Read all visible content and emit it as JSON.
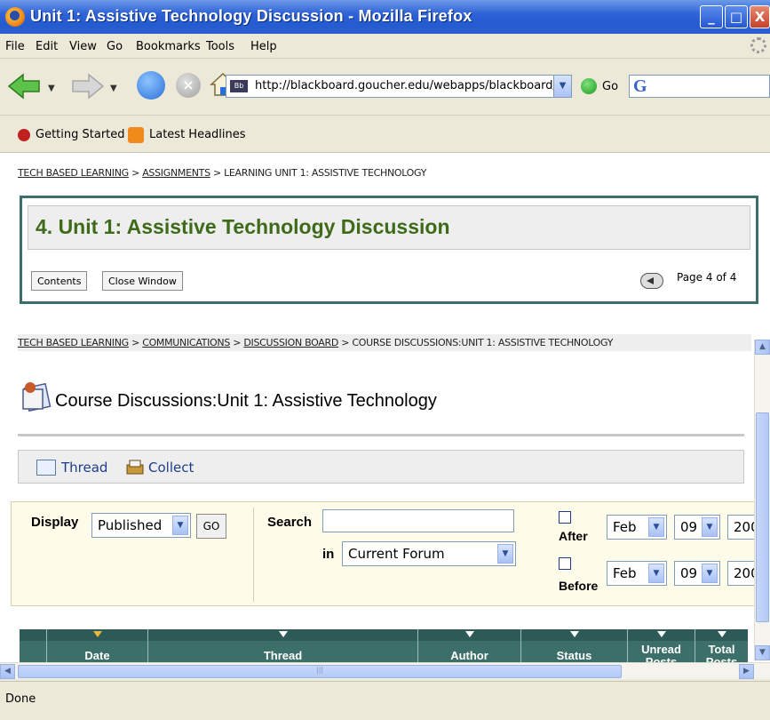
{
  "window": {
    "title": "Unit 1: Assistive Technology Discussion - Mozilla Firefox",
    "minimize": "_",
    "maximize": "□",
    "close": "X"
  },
  "menu": [
    "File",
    "Edit",
    "View",
    "Go",
    "Bookmarks",
    "Tools",
    "Help"
  ],
  "toolbar": {
    "url": "http://blackboard.goucher.edu/webapps/blackboard/cont",
    "site_icon": "Bb",
    "go_label": "Go",
    "search_logo": "G"
  },
  "bookmarks": [
    "Getting Started",
    "Latest Headlines"
  ],
  "assignment": {
    "breadcrumb": {
      "crumb1": "TECH BASED LEARNING",
      "crumb2": "ASSIGNMENTS",
      "crumb3": "LEARNING UNIT 1: ASSISTIVE TECHNOLOGY",
      "sep": " > "
    },
    "title": "4. Unit 1: Assistive Technology Discussion",
    "contents_button": "Contents",
    "close_button": "Close Window",
    "page_indicator": "Page 4 of 4"
  },
  "discussion": {
    "breadcrumb": {
      "crumb1": "TECH BASED LEARNING",
      "crumb2": "COMMUNICATIONS",
      "crumb3": "DISCUSSION BOARD",
      "crumb4": "COURSE DISCUSSIONS:UNIT 1: ASSISTIVE TECHNOLOGY",
      "sep": " > "
    },
    "title": "Course Discussions:Unit 1: Assistive Technology",
    "actions": {
      "thread": "Thread",
      "collect": "Collect"
    },
    "filter": {
      "display_label": "Display",
      "display_value": "Published",
      "go": "GO",
      "search_label": "Search",
      "search_value": "",
      "in_label": "in",
      "in_value": "Current Forum",
      "after_label": "After",
      "before_label": "Before",
      "after_month": "Feb",
      "after_day": "09",
      "after_year": "200",
      "before_month": "Feb",
      "before_day": "09",
      "before_year": "200"
    },
    "table": {
      "columns": [
        "Date",
        "Thread",
        "Author",
        "Status",
        "Unread Posts",
        "Total Posts"
      ]
    }
  },
  "status": "Done",
  "colors": {
    "titlebar": "#245bd0",
    "unit_title": "#3e6b1a",
    "grid_header": "#3c6f6a",
    "link_blue": "#1c3d8c"
  }
}
